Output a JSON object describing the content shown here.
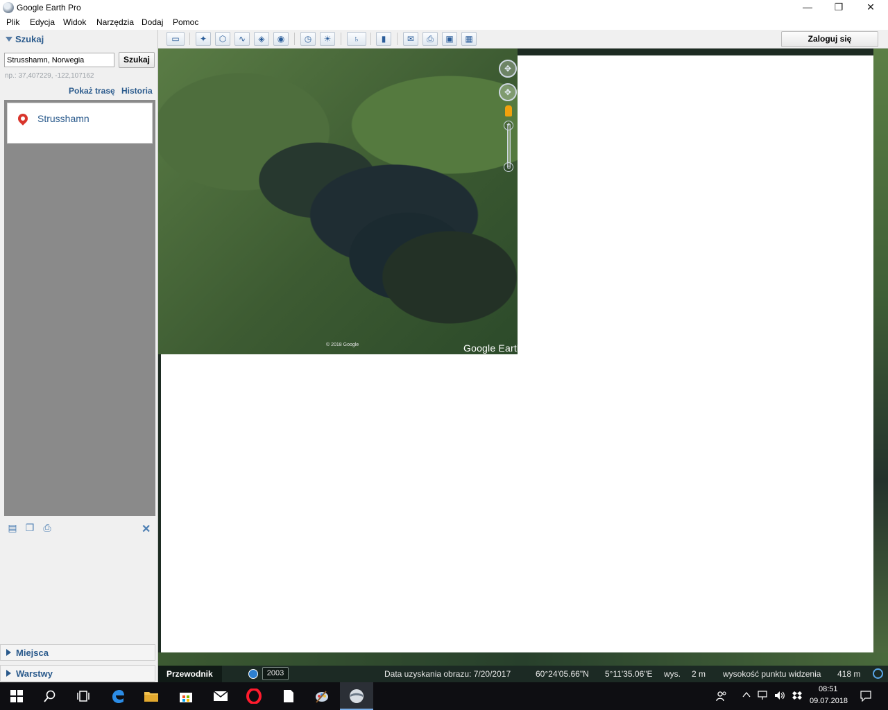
{
  "window": {
    "title": "Google Earth Pro",
    "minimize": "—",
    "maximize": "❐",
    "close": "✕"
  },
  "menu": [
    "Plik",
    "Edycja",
    "Widok",
    "Narzędzia",
    "Dodaj",
    "Pomoc"
  ],
  "toolbar": {
    "login_label": "Zaloguj się",
    "icons": [
      "sidebar-toggle-icon",
      "placemark-icon",
      "polygon-icon",
      "path-icon",
      "image-overlay-icon",
      "record-tour-icon",
      "historical-imagery-icon",
      "sunlight-icon",
      "planets-icon",
      "ruler-icon",
      "email-icon",
      "print-icon",
      "save-image-icon",
      "view-in-maps-icon"
    ]
  },
  "search": {
    "header": "Szukaj",
    "value": "Strusshamn, Norwegia",
    "button_label": "Szukaj",
    "hint": "np.: 37,407229, -122,107162",
    "show_route": "Pokaż trasę",
    "history": "Historia",
    "results": [
      {
        "label": "Strusshamn"
      }
    ]
  },
  "panels": {
    "places": "Miejsca",
    "layers": "Warstwy"
  },
  "map": {
    "copyright": "© 2018 Google",
    "brand": "Google Earth"
  },
  "status": {
    "guide": "Przewodnik",
    "year": "2003",
    "imagery_date": "Data uzyskania obrazu: 7/20/2017",
    "lat": "60°24'05.66\"N",
    "lon": "5°11'35.06\"E",
    "elevation_label": "wys.",
    "elevation": "2 m",
    "eye_alt_label": "wysokość punktu widzenia",
    "eye_alt": "418 m"
  },
  "taskbar": {
    "time": "08:51",
    "date": "09.07.2018"
  }
}
